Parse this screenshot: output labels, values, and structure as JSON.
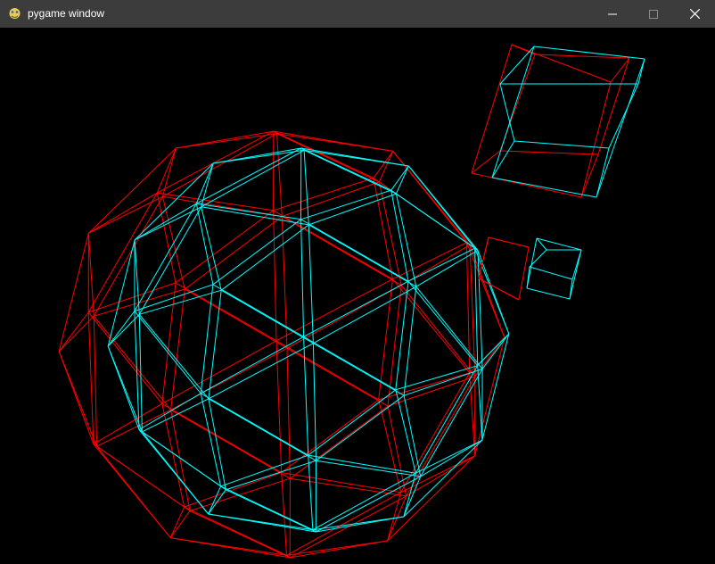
{
  "window": {
    "title": "pygame window",
    "icon": "pygame-snake-icon",
    "controls": [
      "minimize-icon",
      "maximize-icon",
      "close-icon"
    ]
  },
  "scene": {
    "render_mode": "wireframe-anaglyph",
    "background": "#000000",
    "left_eye_color": "#ff0000",
    "right_eye_color": "#00ffff",
    "objects": [
      "geodesic-sphere",
      "large-cube",
      "small-cube"
    ]
  },
  "colors": {
    "titlebar": "#3c3c3c",
    "title_text": "#ffffff"
  }
}
